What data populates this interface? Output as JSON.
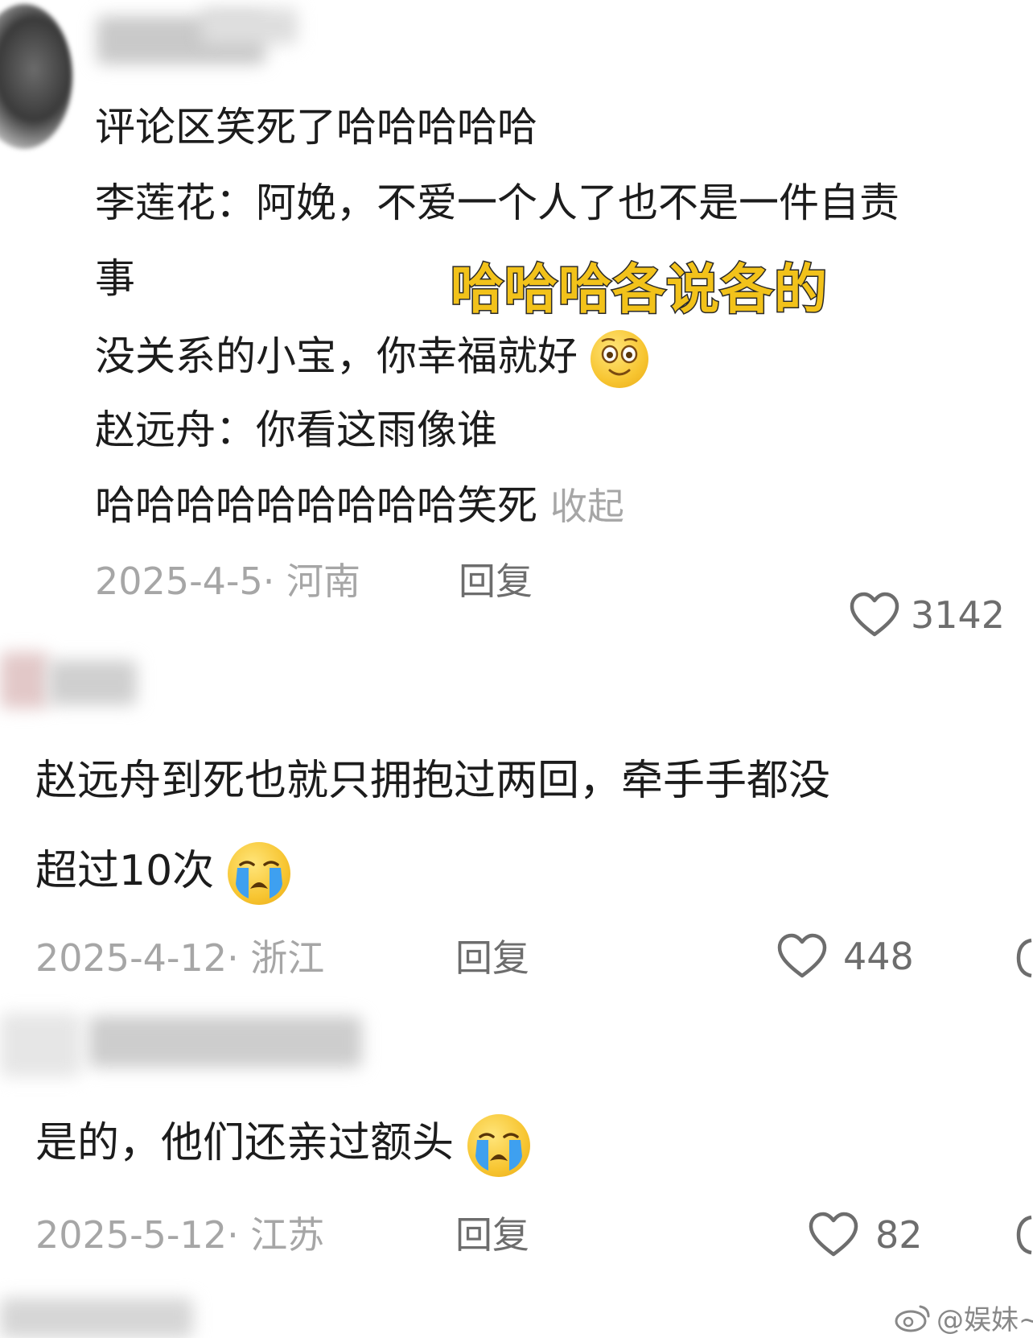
{
  "comments": [
    {
      "lines": [
        "评论区笑死了哈哈哈哈哈",
        "李莲花：阿娩，不爱一个人了也不是一件自责",
        "事",
        "没关系的小宝，你幸福就好",
        "赵远舟：你看这雨像谁",
        "哈哈哈哈哈哈哈哈哈笑死"
      ],
      "collapse_label": "收起",
      "date_location": "2025-4-5· 河南",
      "reply_label": "回复",
      "likes": "3142",
      "emoji": "smiling-face-icon"
    },
    {
      "lines": [
        "赵远舟到死也就只拥抱过两回，牵手手都没",
        "超过10次"
      ],
      "date_location": "2025-4-12· 浙江",
      "reply_label": "回复",
      "likes": "448",
      "emoji": "loudly-crying-face-icon"
    },
    {
      "lines": [
        "是的，他们还亲过额头"
      ],
      "date_location": "2025-5-12· 江苏",
      "reply_label": "回复",
      "likes": "82",
      "emoji": "loudly-crying-face-icon"
    }
  ],
  "overlay_caption": "哈哈哈各说各的",
  "watermark": "@娱妹~",
  "colors": {
    "caption_fill": "#f2c21a",
    "meta_gray": "#a6a6a6",
    "action_gray": "#6d6d6d",
    "emoji_yellow": "#f7c531",
    "tear_blue": "#3ea0f0"
  }
}
